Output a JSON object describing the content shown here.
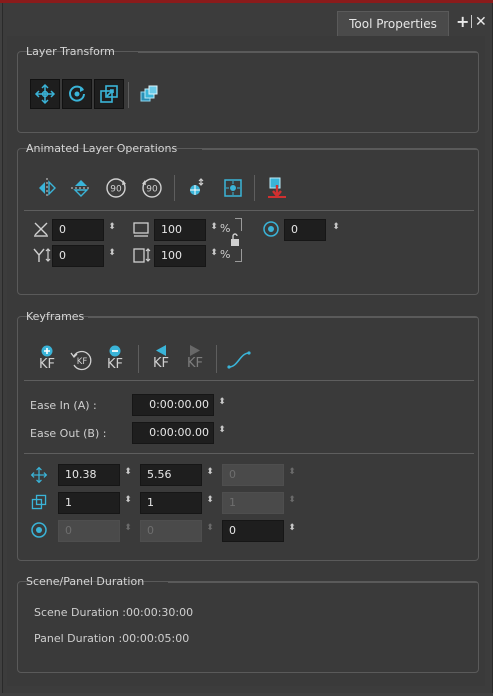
{
  "tab": {
    "label": "Tool Properties",
    "add_icon": "plus-icon",
    "close_icon": "x-icon"
  },
  "layer_transform": {
    "title": "Layer Transform",
    "tools": [
      "translate-tool-icon",
      "rotate-tool-icon",
      "scale-tool-icon",
      "3d-transform-icon"
    ]
  },
  "animated_ops": {
    "title": "Animated Layer Operations",
    "tools": [
      "flip-horizontal-icon",
      "flip-vertical-icon",
      "rotate-90-cw-icon",
      "rotate-90-ccw-icon",
      "center-on-selection-icon",
      "fit-to-camera-icon",
      "reset-transform-icon"
    ],
    "offset_x": "0",
    "offset_y": "0",
    "width": "100",
    "height": "100",
    "percent": "%",
    "angle": "0"
  },
  "keyframes": {
    "title": "Keyframes",
    "tools": [
      "add-keyframe-icon",
      "reset-keyframe-icon",
      "delete-keyframe-icon",
      "previous-keyframe-icon",
      "next-keyframe-icon",
      "ease-curve-icon"
    ],
    "kf_text": "KF",
    "ease_in_label": "Ease In (A) :",
    "ease_in_value": "0:00:00.00",
    "ease_out_label": "Ease Out (B) :",
    "ease_out_value": "0:00:00.00",
    "position": {
      "x": "10.38",
      "y": "5.56",
      "z": "0"
    },
    "scale": {
      "x": "1",
      "y": "1",
      "z": "1"
    },
    "rotation": {
      "x": "0",
      "y": "0",
      "z": "0"
    }
  },
  "duration": {
    "title": "Scene/Panel Duration",
    "scene": "Scene Duration :00:00:30:00",
    "panel": "Panel Duration :00:00:05:00"
  },
  "colors": {
    "accent": "#3ab4d8",
    "red": "#d03030",
    "field_bg": "#1e1e1e"
  }
}
